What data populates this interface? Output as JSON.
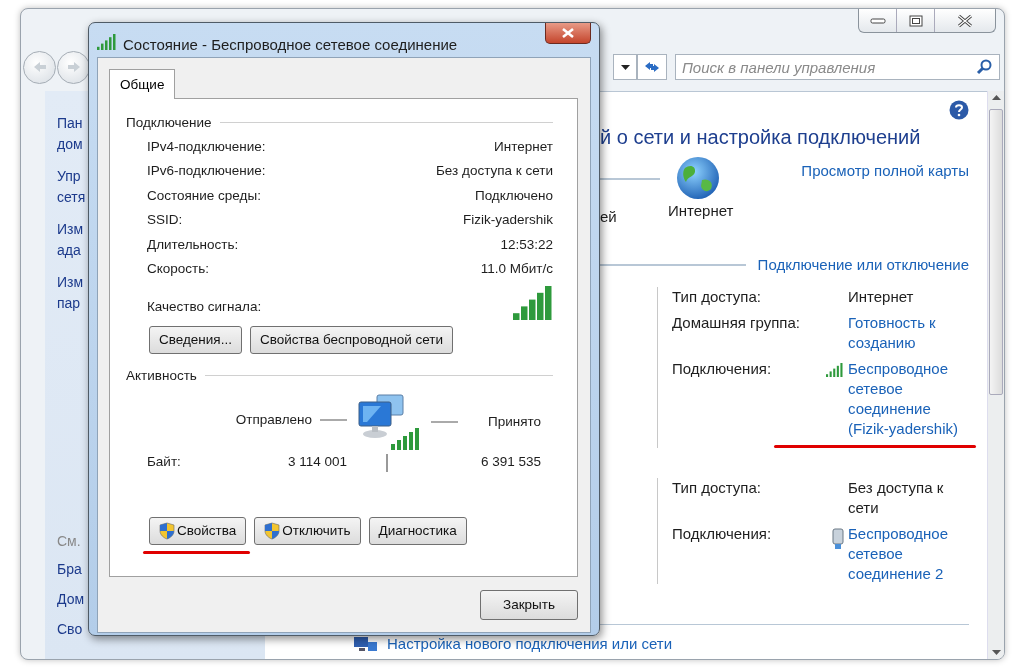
{
  "main_window": {
    "search": {
      "placeholder": "Поиск в панели управления"
    },
    "sidebar": {
      "items": [
        {
          "lines": [
            "Пан",
            "дом"
          ]
        },
        {
          "lines": [
            "Упр",
            "сетя"
          ]
        },
        {
          "lines": [
            "Изм",
            "ада"
          ]
        },
        {
          "lines": [
            "Изм",
            "пар"
          ]
        }
      ],
      "see_also": {
        "label": "См.",
        "items": [
          "Бра",
          "Дом",
          "Сво"
        ]
      }
    },
    "heading": "й о сети и настройка подключений",
    "map": {
      "left_label": "ей",
      "internet_label": "Интернет",
      "full_map_link": "Просмотр полной карты"
    },
    "connect_link": "Подключение или отключение",
    "networks": [
      {
        "rows": [
          {
            "label": "Тип доступа:",
            "value": "Интернет",
            "kind": "text"
          },
          {
            "label": "Домашняя группа:",
            "value": "Готовность к созданию",
            "kind": "link"
          },
          {
            "label": "Подключения:",
            "value": "Беспроводное сетевое соединение (Fizik-yadershik)",
            "kind": "connection",
            "highlighted": true
          }
        ]
      },
      {
        "rows": [
          {
            "label": "Тип доступа:",
            "value": "Без доступа к сети",
            "kind": "text"
          },
          {
            "label": "Подключения:",
            "value": "Беспроводное сетевое соединение 2",
            "kind": "connection",
            "highlighted": false
          }
        ]
      }
    ],
    "setup_link": "Настройка нового подключения или сети"
  },
  "dialog": {
    "title": "Состояние - Беспроводное сетевое соединение",
    "tabs": [
      {
        "label": "Общие",
        "selected": true
      }
    ],
    "connection": {
      "heading": "Подключение",
      "rows": [
        {
          "label": "IPv4-подключение:",
          "value": "Интернет"
        },
        {
          "label": "IPv6-подключение:",
          "value": "Без доступа к сети"
        },
        {
          "label": "Состояние среды:",
          "value": "Подключено"
        },
        {
          "label": "SSID:",
          "value": "Fizik-yadershik"
        },
        {
          "label": "Длительность:",
          "value": "12:53:22"
        },
        {
          "label": "Скорость:",
          "value": "11.0 Мбит/с"
        }
      ],
      "signal_label": "Качество сигнала:"
    },
    "connection_buttons": [
      "Сведения...",
      "Свойства беспроводной сети"
    ],
    "activity": {
      "heading": "Активность",
      "sent_label": "Отправлено",
      "received_label": "Принято",
      "bytes_label": "Байт:",
      "bytes_sent": "3 114 001",
      "bytes_received": "6 391 535"
    },
    "action_buttons": [
      {
        "label": "Свойства",
        "shield": true,
        "highlighted": true
      },
      {
        "label": "Отключить",
        "shield": true,
        "highlighted": false
      },
      {
        "label": "Диагностика",
        "shield": false,
        "highlighted": false
      }
    ],
    "close_button": "Закрыть"
  }
}
